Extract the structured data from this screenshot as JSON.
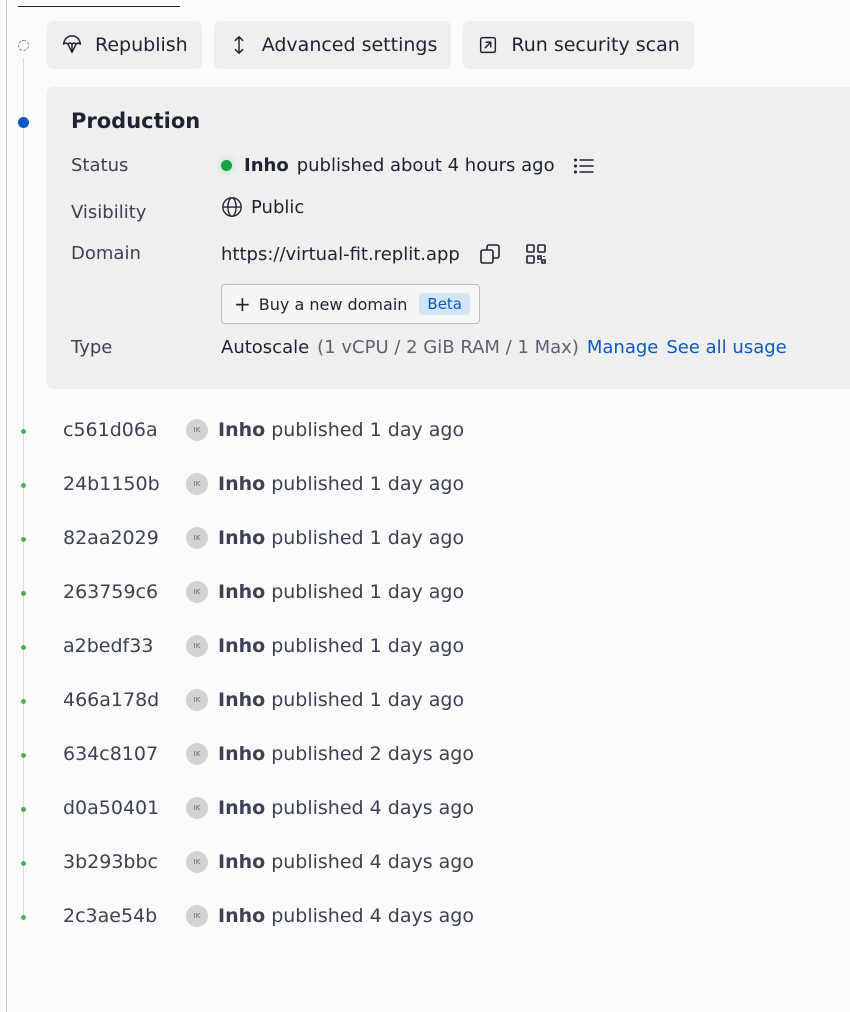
{
  "toolbar": {
    "republish_label": "Republish",
    "advanced_label": "Advanced settings",
    "security_label": "Run security scan"
  },
  "production": {
    "title": "Production",
    "status_label": "Status",
    "status_author": "Inho",
    "status_text": "published about 4 hours ago",
    "visibility_label": "Visibility",
    "visibility_value": "Public",
    "domain_label": "Domain",
    "domain_value": "https://virtual-fit.replit.app",
    "buy_domain_label": "Buy a new domain",
    "beta_label": "Beta",
    "type_label": "Type",
    "type_value": "Autoscale",
    "type_specs": "(1 vCPU / 2 GiB RAM / 1 Max)",
    "manage_link": "Manage",
    "usage_link": "See all usage",
    "status_color": "#16a34a",
    "accent_color": "#0b5bbf"
  },
  "deployments": [
    {
      "hash": "c561d06a",
      "avatar": "IK",
      "author": "Inho",
      "text": "published 1 day ago"
    },
    {
      "hash": "24b1150b",
      "avatar": "IK",
      "author": "Inho",
      "text": "published 1 day ago"
    },
    {
      "hash": "82aa2029",
      "avatar": "IK",
      "author": "Inho",
      "text": "published 1 day ago"
    },
    {
      "hash": "263759c6",
      "avatar": "IK",
      "author": "Inho",
      "text": "published 1 day ago"
    },
    {
      "hash": "a2bedf33",
      "avatar": "IK",
      "author": "Inho",
      "text": "published 1 day ago"
    },
    {
      "hash": "466a178d",
      "avatar": "IK",
      "author": "Inho",
      "text": "published 1 day ago"
    },
    {
      "hash": "634c8107",
      "avatar": "IK",
      "author": "Inho",
      "text": "published 2 days ago"
    },
    {
      "hash": "d0a50401",
      "avatar": "IK",
      "author": "Inho",
      "text": "published 4 days ago"
    },
    {
      "hash": "3b293bbc",
      "avatar": "IK",
      "author": "Inho",
      "text": "published 4 days ago"
    },
    {
      "hash": "2c3ae54b",
      "avatar": "IK",
      "author": "Inho",
      "text": "published 4 days ago"
    }
  ]
}
